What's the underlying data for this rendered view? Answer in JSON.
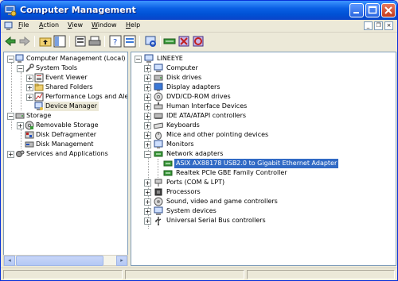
{
  "window": {
    "title": "Computer Management"
  },
  "menu": [
    {
      "label": "File",
      "accel": "F",
      "rest": "ile"
    },
    {
      "label": "Action",
      "accel": "A",
      "rest": "ction"
    },
    {
      "label": "View",
      "accel": "V",
      "rest": "iew"
    },
    {
      "label": "Window",
      "accel": "W",
      "rest": "indow"
    },
    {
      "label": "Help",
      "accel": "H",
      "rest": "elp"
    }
  ],
  "mdi_controls": [
    "_",
    "❐",
    "×"
  ],
  "left_tree": [
    {
      "label": "Computer Management (Local)",
      "icon": "computer-mgmt-icon"
    },
    {
      "label": "System Tools",
      "icon": "tools-icon"
    },
    {
      "label": "Event Viewer",
      "icon": "event-viewer-icon"
    },
    {
      "label": "Shared Folders",
      "icon": "folder-icon"
    },
    {
      "label": "Performance Logs and Alerts",
      "icon": "perf-icon"
    },
    {
      "label": "Device Manager",
      "icon": "device-manager-icon"
    },
    {
      "label": "Storage",
      "icon": "storage-icon"
    },
    {
      "label": "Removable Storage",
      "icon": "removable-storage-icon"
    },
    {
      "label": "Disk Defragmenter",
      "icon": "defrag-icon"
    },
    {
      "label": "Disk Management",
      "icon": "disk-management-icon"
    },
    {
      "label": "Services and Applications",
      "icon": "services-icon"
    }
  ],
  "right_tree": [
    {
      "label": "LINEEYE",
      "icon": "computer-icon"
    },
    {
      "label": "Computer",
      "icon": "computer-icon"
    },
    {
      "label": "Disk drives",
      "icon": "disk-drive-icon"
    },
    {
      "label": "Display adapters",
      "icon": "display-icon"
    },
    {
      "label": "DVD/CD-ROM drives",
      "icon": "cdrom-icon"
    },
    {
      "label": "Human Interface Devices",
      "icon": "hid-icon"
    },
    {
      "label": "IDE ATA/ATAPI controllers",
      "icon": "ide-icon"
    },
    {
      "label": "Keyboards",
      "icon": "keyboard-icon"
    },
    {
      "label": "Mice and other pointing devices",
      "icon": "mouse-icon"
    },
    {
      "label": "Monitors",
      "icon": "monitor-icon"
    },
    {
      "label": "Network adapters",
      "icon": "network-icon"
    },
    {
      "label": "ASIX AX88178 USB2.0 to Gigabit Ethernet Adapter",
      "icon": "network-card-icon"
    },
    {
      "label": "Realtek PCIe GBE Family Controller",
      "icon": "network-card-icon"
    },
    {
      "label": "Ports (COM & LPT)",
      "icon": "port-icon"
    },
    {
      "label": "Processors",
      "icon": "processor-icon"
    },
    {
      "label": "Sound, video and game controllers",
      "icon": "sound-icon"
    },
    {
      "label": "System devices",
      "icon": "system-icon"
    },
    {
      "label": "Universal Serial Bus controllers",
      "icon": "usb-icon"
    }
  ],
  "expanders": {
    "plus": "+",
    "minus": "−"
  },
  "scroll": {
    "left": "◂",
    "right": "▸"
  },
  "colors": {
    "titlebar": "#0A5FE4",
    "selection": "#316AC5",
    "accent": "#ECE9D8"
  }
}
